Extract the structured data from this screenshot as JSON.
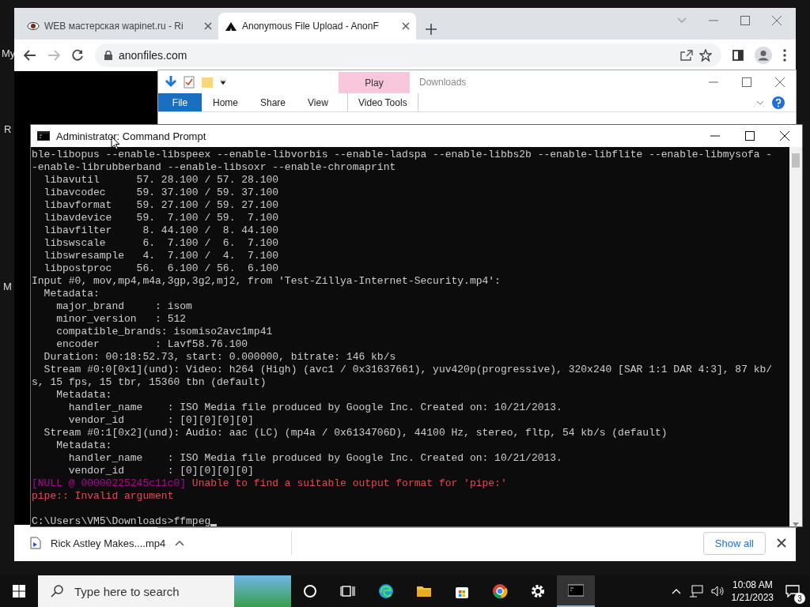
{
  "desktop": {
    "labels": [
      {
        "text": "My",
        "kind": "top"
      },
      {
        "text": "R",
        "kind": "middle"
      },
      {
        "text": "M",
        "kind": "bottom"
      }
    ]
  },
  "browser": {
    "tabs": [
      {
        "title": "WEB мастерская wapinet.ru - Ri",
        "selected": false
      },
      {
        "title": "Anonymous File Upload - AnonF",
        "selected": true
      }
    ],
    "address": "anonfiles.com",
    "download_bar": {
      "file": "Rick Astley Makes....mp4",
      "show_all": "Show all"
    }
  },
  "explorer": {
    "context_tab": "Play",
    "title": "Downloads",
    "ribbon_tabs": [
      {
        "label": "File",
        "kind": "file"
      },
      {
        "label": "Home",
        "kind": "tab"
      },
      {
        "label": "Share",
        "kind": "tab"
      },
      {
        "label": "View",
        "kind": "tab"
      },
      {
        "label": "Video Tools",
        "kind": "context"
      }
    ]
  },
  "terminal": {
    "title": "Administrator: Command Prompt",
    "lines": [
      {
        "kind": "output",
        "text": "ble-libopus --enable-libspeex --enable-libvorbis --enable-ladspa --enable-libbs2b --enable-libflite --enable-libmysofa -"
      },
      {
        "kind": "output",
        "text": "-enable-librubberband --enable-libsoxr --enable-chromaprint"
      },
      {
        "kind": "output",
        "text": "  libavutil      57. 28.100 / 57. 28.100"
      },
      {
        "kind": "output",
        "text": "  libavcodec     59. 37.100 / 59. 37.100"
      },
      {
        "kind": "output",
        "text": "  libavformat    59. 27.100 / 59. 27.100"
      },
      {
        "kind": "output",
        "text": "  libavdevice    59.  7.100 / 59.  7.100"
      },
      {
        "kind": "output",
        "text": "  libavfilter     8. 44.100 /  8. 44.100"
      },
      {
        "kind": "output",
        "text": "  libswscale      6.  7.100 /  6.  7.100"
      },
      {
        "kind": "output",
        "text": "  libswresample   4.  7.100 /  4.  7.100"
      },
      {
        "kind": "output",
        "text": "  libpostproc    56.  6.100 / 56.  6.100"
      },
      {
        "kind": "output",
        "text": "Input #0, mov,mp4,m4a,3gp,3g2,mj2, from 'Test-Zillya-Internet-Security.mp4':"
      },
      {
        "kind": "output",
        "text": "  Metadata:"
      },
      {
        "kind": "output",
        "text": "    major_brand     : isom"
      },
      {
        "kind": "output",
        "text": "    minor_version   : 512"
      },
      {
        "kind": "output",
        "text": "    compatible_brands: isomiso2avc1mp41"
      },
      {
        "kind": "output",
        "text": "    encoder         : Lavf58.76.100"
      },
      {
        "kind": "output",
        "text": "  Duration: 00:18:52.73, start: 0.000000, bitrate: 146 kb/s"
      },
      {
        "kind": "output",
        "text": "  Stream #0:0[0x1](und): Video: h264 (High) (avc1 / 0x31637661), yuv420p(progressive), 320x240 [SAR 1:1 DAR 4:3], 87 kb/"
      },
      {
        "kind": "output",
        "text": "s, 15 fps, 15 tbr, 15360 tbn (default)"
      },
      {
        "kind": "output",
        "text": "    Metadata:"
      },
      {
        "kind": "output",
        "text": "      handler_name    : ISO Media file produced by Google Inc. Created on: 10/21/2013."
      },
      {
        "kind": "output",
        "text": "      vendor_id       : [0][0][0][0]"
      },
      {
        "kind": "output",
        "text": "  Stream #0:1[0x2](und): Audio: aac (LC) (mp4a / 0x6134706D), 44100 Hz, stereo, fltp, 54 kb/s (default)"
      },
      {
        "kind": "output",
        "text": "    Metadata:"
      },
      {
        "kind": "output",
        "text": "      handler_name    : ISO Media file produced by Google Inc. Created on: 10/21/2013."
      },
      {
        "kind": "output",
        "text": "      vendor_id       : [0][0][0][0]"
      },
      {
        "kind": "error",
        "source": "[NULL @ 00000225245c11c0]",
        "text": " Unable to find a suitable output format for 'pipe:'"
      },
      {
        "kind": "error",
        "text": "pipe:: Invalid argument"
      },
      {
        "kind": "prompt",
        "text": "C:\\Users\\VM5\\Downloads>ffmpeg"
      }
    ]
  },
  "taskbar": {
    "search": {
      "placeholder": "Type here to search"
    },
    "apps": [
      {
        "kind": "cortana",
        "active": false
      },
      {
        "kind": "taskview",
        "active": false
      },
      {
        "kind": "edge",
        "active": false
      },
      {
        "kind": "folder",
        "active": false
      },
      {
        "kind": "store",
        "active": false
      },
      {
        "kind": "chrome",
        "active": false
      },
      {
        "kind": "settings",
        "active": false
      },
      {
        "kind": "terminal",
        "active": true
      }
    ],
    "time": "10:08 AM",
    "date": "1/21/2023",
    "notifications": "3"
  }
}
